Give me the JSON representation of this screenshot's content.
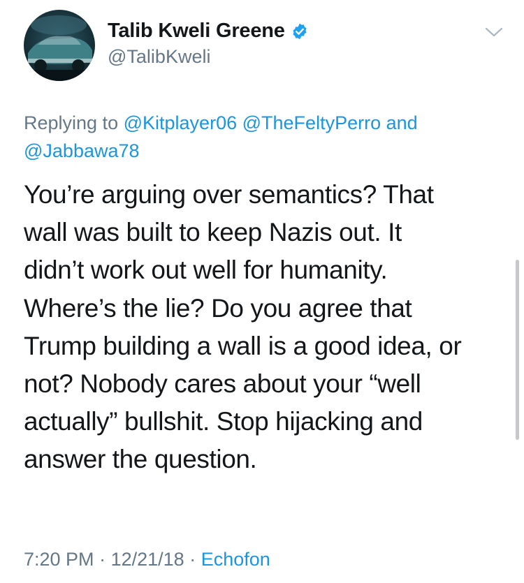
{
  "author": {
    "display_name": "Talib Kweli Greene",
    "handle": "@TalibKweli",
    "verified_icon": "verified-badge-icon",
    "avatar_icon": "avatar-photo"
  },
  "menu": {
    "icon": "chevron-down-icon"
  },
  "reply": {
    "prefix": "Replying to",
    "mention_1": "@Kitplayer06",
    "mention_2": "@TheFeltyPerro",
    "conjunction": "and",
    "mention_3": "@Jabbawa78"
  },
  "tweet": {
    "lines": [
      "You’re arguing over semantics? That",
      "wall was built to keep Nazis out. It",
      "didn’t work out well for humanity.",
      "Where’s the lie? Do you agree that",
      "Trump building a wall is a good idea, or",
      "not? Nobody cares about your “well",
      "actually” bullshit. Stop hijacking and",
      "answer the question."
    ]
  },
  "meta": {
    "time": "7:20 PM",
    "separator": "·",
    "date": "12/21/18",
    "source": "Echofon"
  },
  "colors": {
    "text": "#14171a",
    "secondary": "#657786",
    "link": "#1b95e0",
    "verified": "#1da1f2"
  }
}
